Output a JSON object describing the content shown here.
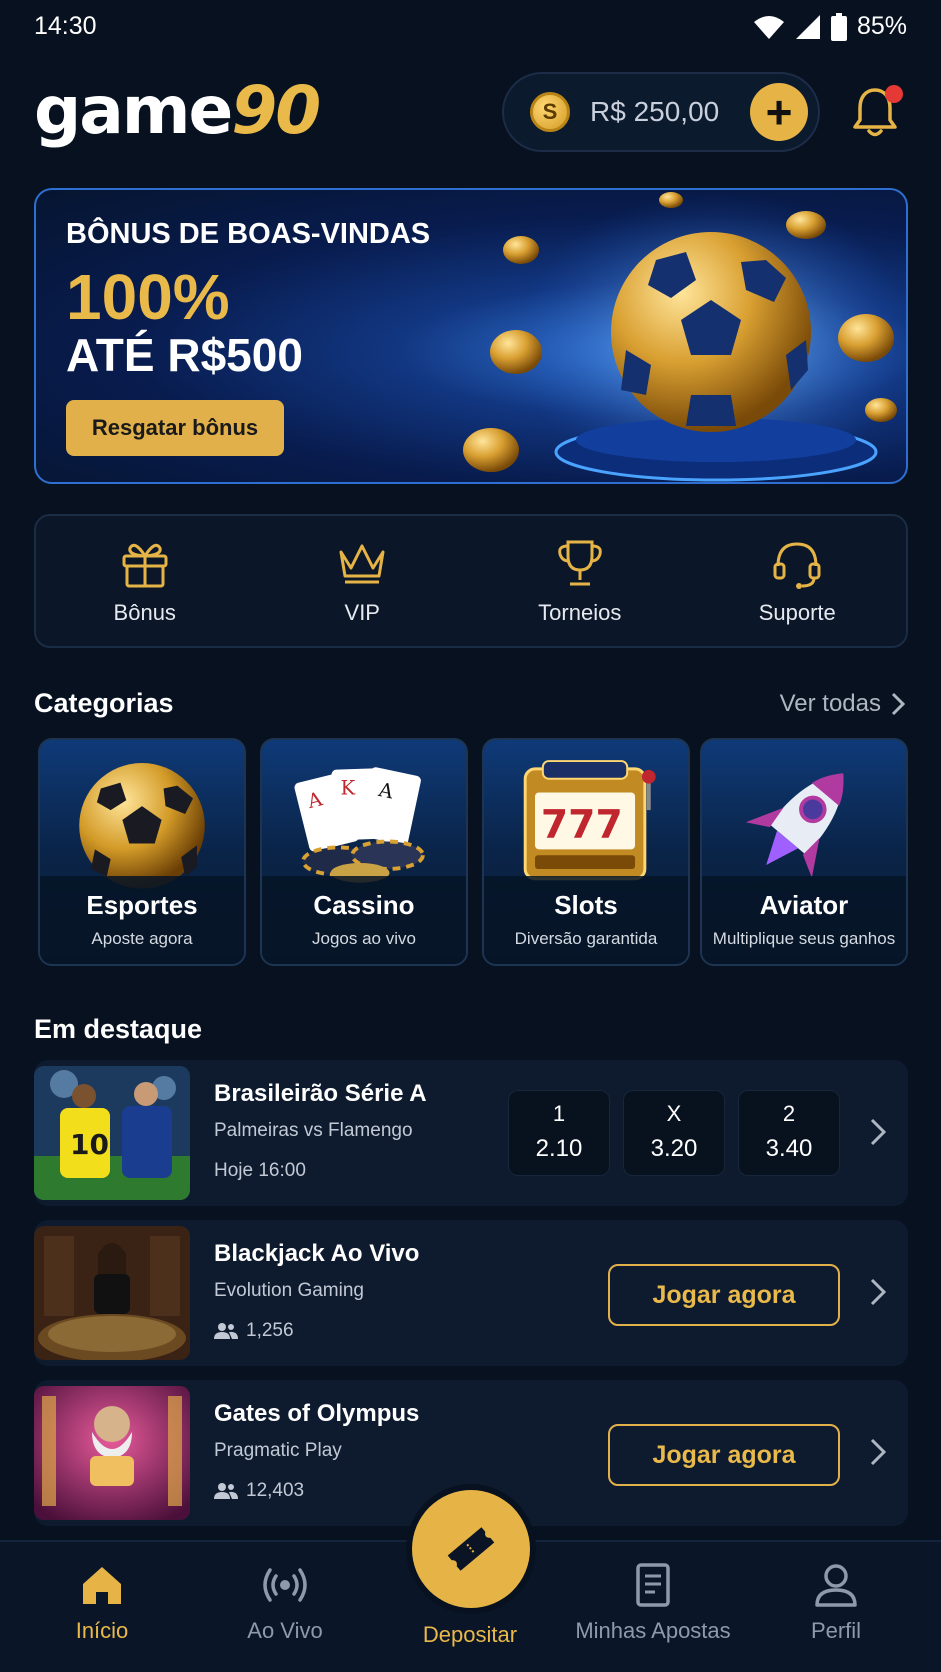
{
  "status_bar": {
    "time": "14:30",
    "battery": "85%"
  },
  "header": {
    "logo_text": "game",
    "logo_accent": "90",
    "balance": "R$ 250,00",
    "coin_symbol": "S"
  },
  "banner": {
    "title": "BÔNUS DE BOAS-VINDAS",
    "percent": "100%",
    "amount": "ATÉ R$500",
    "cta": "Resgatar bônus"
  },
  "quick_actions": [
    {
      "label": "Bônus",
      "icon": "gift-icon"
    },
    {
      "label": "VIP",
      "icon": "crown-icon"
    },
    {
      "label": "Torneios",
      "icon": "trophy-icon"
    },
    {
      "label": "Suporte",
      "icon": "headset-icon"
    }
  ],
  "categories": {
    "title": "Categorias",
    "see_all": "Ver todas",
    "items": [
      {
        "name": "Esportes",
        "subtitle": "Aposte agora",
        "icon": "soccer-ball-icon"
      },
      {
        "name": "Cassino",
        "subtitle": "Jogos ao vivo",
        "icon": "cards-chips-icon"
      },
      {
        "name": "Slots",
        "subtitle": "Diversão garantida",
        "icon": "slot-machine-icon"
      },
      {
        "name": "Aviator",
        "subtitle": "Multiplique seus ganhos",
        "icon": "rocket-icon"
      }
    ]
  },
  "featured": {
    "title": "Em destaque",
    "match": {
      "league": "Brasileirão Série A",
      "teams": "Palmeiras vs Flamengo",
      "time": "Hoje 16:00",
      "odds": [
        {
          "label": "1",
          "value": "2.10"
        },
        {
          "label": "X",
          "value": "3.20"
        },
        {
          "label": "2",
          "value": "3.40"
        }
      ]
    },
    "games": [
      {
        "title": "Blackjack Ao Vivo",
        "provider": "Evolution Gaming",
        "players": "1,256",
        "cta": "Jogar agora"
      },
      {
        "title": "Gates of Olympus",
        "provider": "Pragmatic Play",
        "players": "12,403",
        "cta": "Jogar agora"
      }
    ]
  },
  "bottom_nav": [
    {
      "label": "Início",
      "icon": "home-icon",
      "active": true
    },
    {
      "label": "Ao Vivo",
      "icon": "broadcast-icon",
      "active": false
    },
    {
      "label": "Depositar",
      "icon": "ticket-icon",
      "active": true
    },
    {
      "label": "Minhas Apostas",
      "icon": "document-icon",
      "active": false
    },
    {
      "label": "Perfil",
      "icon": "user-icon",
      "active": false
    }
  ],
  "colors": {
    "background": "#07111f",
    "accent": "#e6b446",
    "card": "#0e1b2f",
    "banner_border": "#2f6fd1"
  }
}
